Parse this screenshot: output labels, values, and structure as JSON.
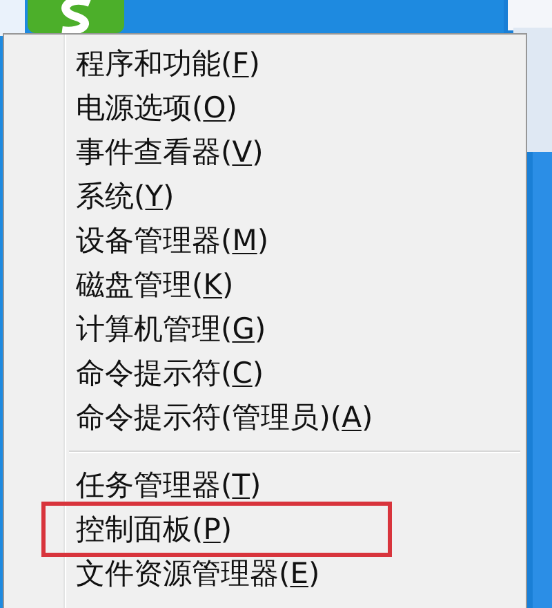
{
  "menu": {
    "items": [
      {
        "label": "程序和功能(F)",
        "kind": "command",
        "highlighted": false
      },
      {
        "label": "电源选项(O)",
        "kind": "command",
        "highlighted": false
      },
      {
        "label": "事件查看器(V)",
        "kind": "command",
        "highlighted": false
      },
      {
        "label": "系统(Y)",
        "kind": "command",
        "highlighted": false
      },
      {
        "label": "设备管理器(M)",
        "kind": "command",
        "highlighted": false
      },
      {
        "label": "磁盘管理(K)",
        "kind": "command",
        "highlighted": false
      },
      {
        "label": "计算机管理(G)",
        "kind": "command",
        "highlighted": false
      },
      {
        "label": "命令提示符(C)",
        "kind": "command",
        "highlighted": false
      },
      {
        "label": "命令提示符(管理员)(A)",
        "kind": "command",
        "highlighted": false
      },
      {
        "kind": "separator"
      },
      {
        "label": "任务管理器(T)",
        "kind": "command",
        "highlighted": false
      },
      {
        "label": "控制面板(P)",
        "kind": "command",
        "highlighted": true
      },
      {
        "label": "文件资源管理器(E)",
        "kind": "command",
        "highlighted": false
      }
    ]
  }
}
